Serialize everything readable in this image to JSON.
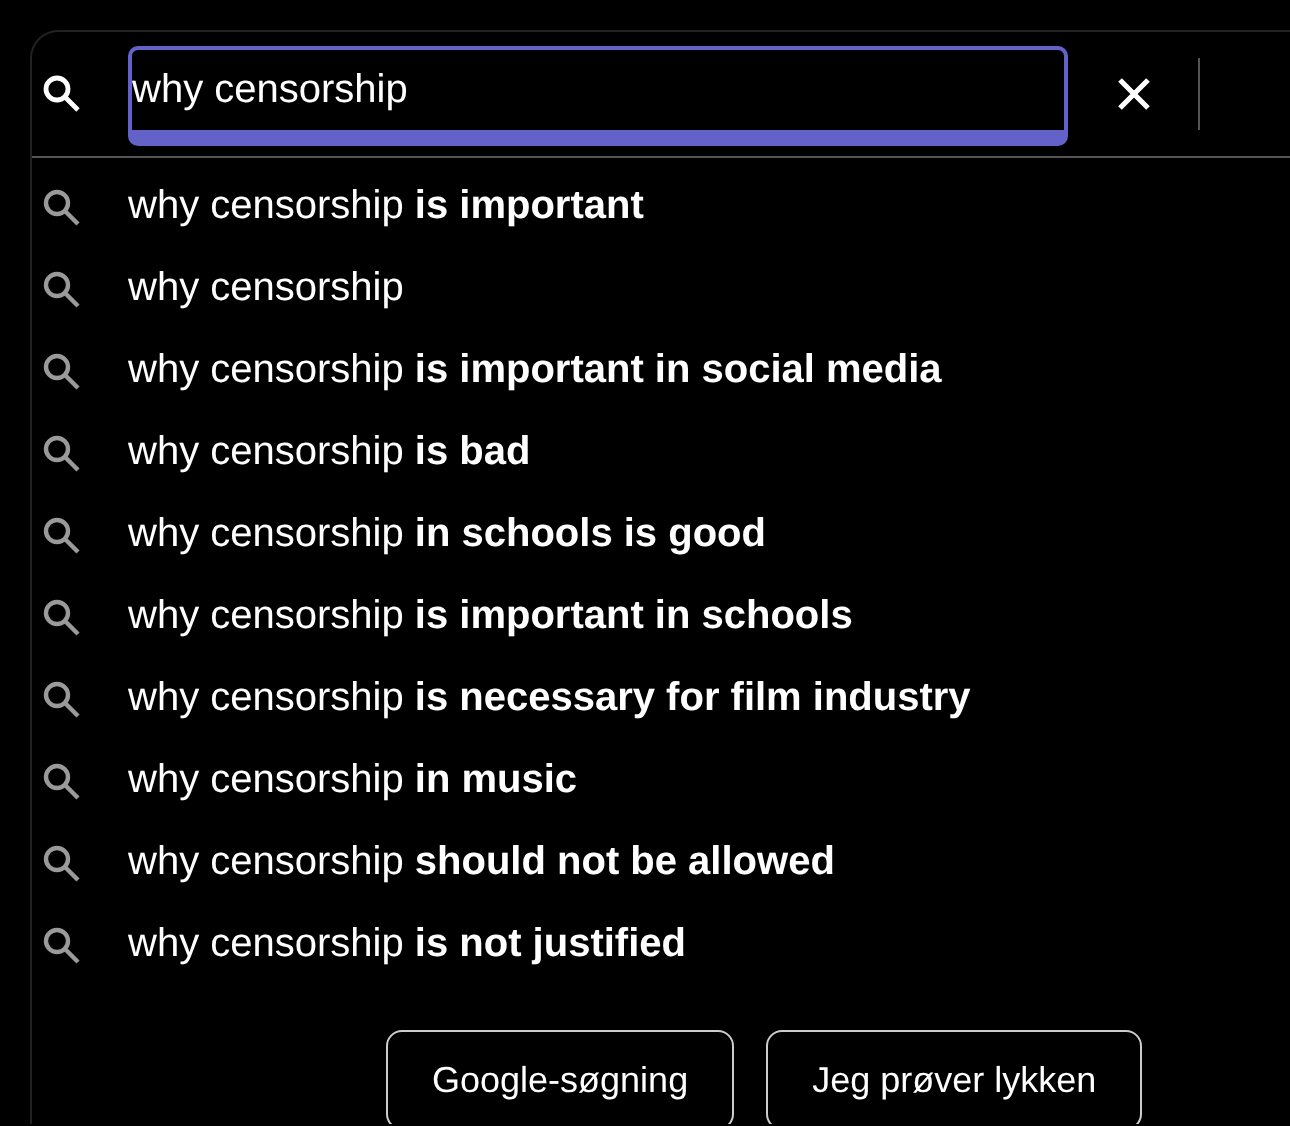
{
  "search": {
    "value": "why censorship"
  },
  "suggestions": [
    {
      "text": "why censorship **is important**"
    },
    {
      "text": "why censorship"
    },
    {
      "text": "why censorship **is important in social media**"
    },
    {
      "text": "why censorship **is bad**"
    },
    {
      "text": "why censorship **in schools is good**"
    },
    {
      "text": "why censorship **is important in schools**"
    },
    {
      "text": "why censorship **is necessary for film industry**"
    },
    {
      "text": "why censorship **in music**"
    },
    {
      "text": "why censorship **should not be allowed**"
    },
    {
      "text": "why censorship **is not justified**"
    }
  ],
  "buttons": [
    "Google-søgning",
    "Jeg prøver lykken"
  ]
}
